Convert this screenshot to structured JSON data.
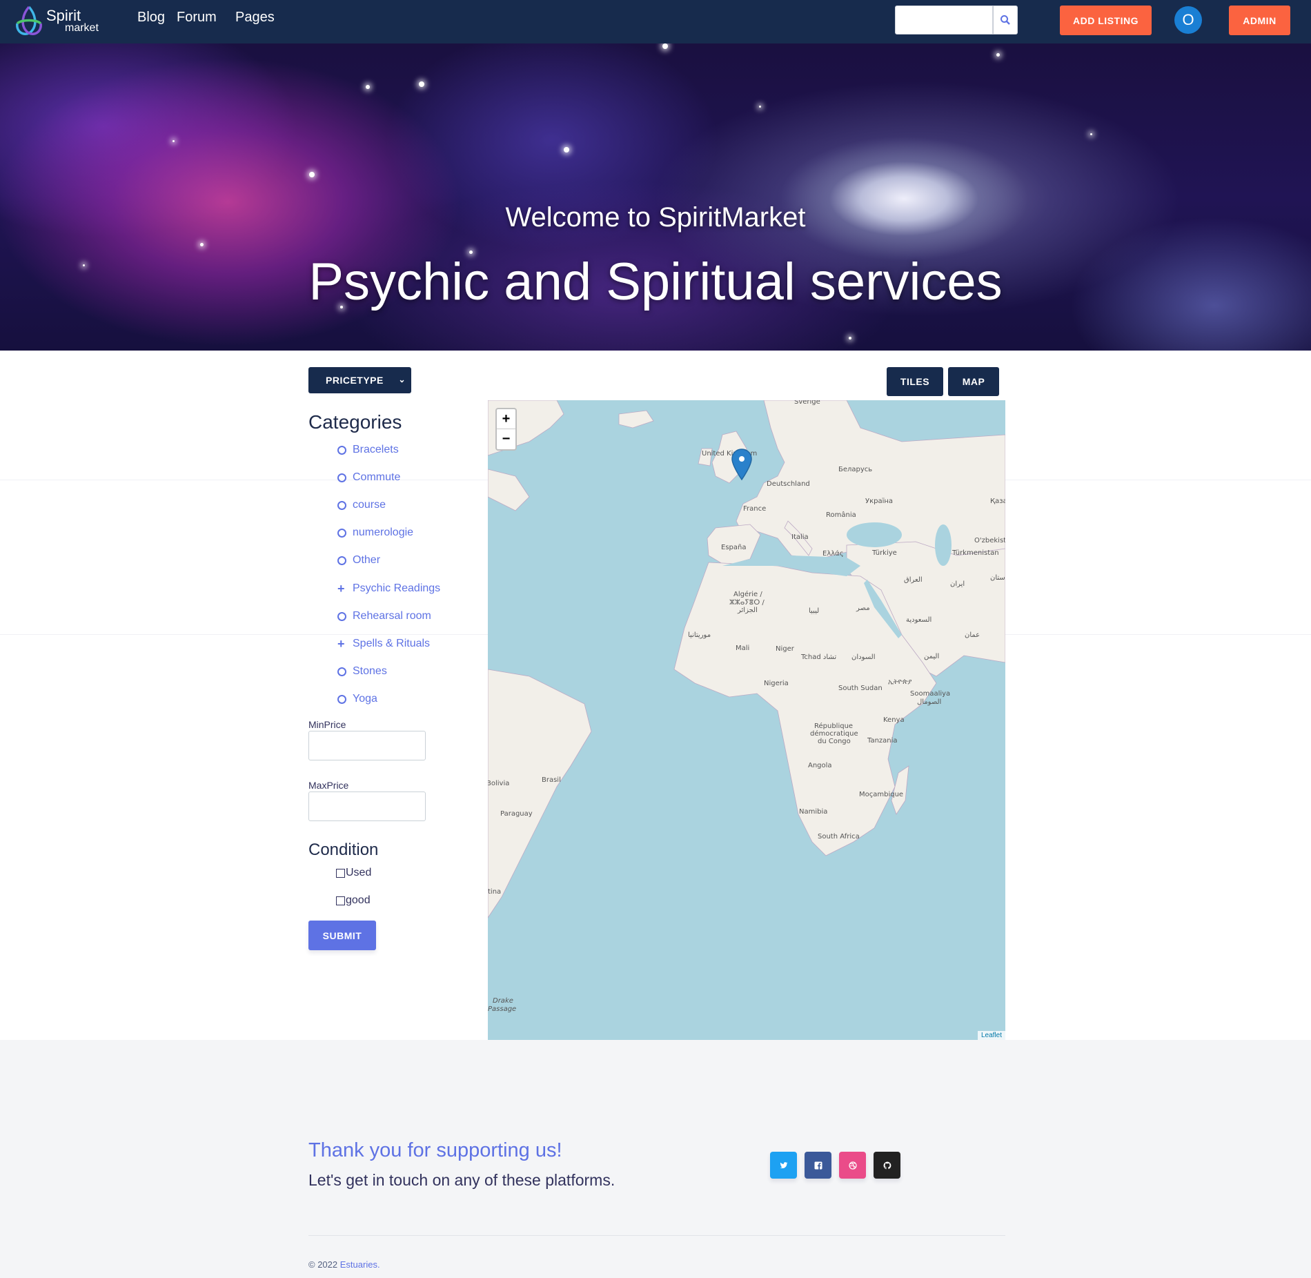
{
  "brand": {
    "line1": "Spirit",
    "line2": "market"
  },
  "nav": {
    "blog": "Blog",
    "forum": "Forum",
    "pages": "Pages"
  },
  "header": {
    "search_placeholder": "",
    "add_listing": "ADD LISTING",
    "avatar_initial": "O",
    "admin": "ADMIN"
  },
  "hero": {
    "subtitle": "Welcome to SpiritMarket",
    "title": "Psychic and Spiritual services"
  },
  "filters": {
    "pricetype": "PRICETYPE",
    "categories_title": "Categories",
    "categories": [
      {
        "label": "Bracelets",
        "icon": "circle"
      },
      {
        "label": "Commute",
        "icon": "circle"
      },
      {
        "label": "course",
        "icon": "circle"
      },
      {
        "label": "numerologie",
        "icon": "circle"
      },
      {
        "label": "Other",
        "icon": "circle"
      },
      {
        "label": "Psychic Readings",
        "icon": "plus"
      },
      {
        "label": "Rehearsal room",
        "icon": "circle"
      },
      {
        "label": "Spells & Rituals",
        "icon": "plus"
      },
      {
        "label": "Stones",
        "icon": "circle"
      },
      {
        "label": "Yoga",
        "icon": "circle"
      }
    ],
    "min_price_label": "MinPrice",
    "max_price_label": "MaxPrice",
    "min_price_value": "",
    "max_price_value": "",
    "condition_title": "Condition",
    "conditions": [
      {
        "label": "Used",
        "checked": false
      },
      {
        "label": "good",
        "checked": false
      }
    ],
    "submit": "SUBMIT"
  },
  "view_toggle": {
    "tiles": "TILES",
    "map": "MAP"
  },
  "map": {
    "zoom_in": "+",
    "zoom_out": "−",
    "attribution": "Leaflet",
    "labels": {
      "sverige": "Sverige",
      "uk": "United Kingdom",
      "belarus": "Беларусь",
      "deutschland": "Deutschland",
      "ukraina": "Україна",
      "kaz": "Қаза",
      "france": "France",
      "romania": "România",
      "uzbek": "O'zbekist",
      "italia": "Italia",
      "espana": "España",
      "ellas": "Ελλάς",
      "turkiye": "Türkiye",
      "turkmen": "Türkmenistan",
      "iraq": "العراق",
      "iran": "ایران",
      "stan": "ستان",
      "algerie": "Algérie /",
      "algerie2": "ⵣⵣⴰⵢⴻⵔ /",
      "algerie3": "الجزائر",
      "libya": "ليبيا",
      "egypt": "مصر",
      "saudi": "السعودية",
      "oman": "عمان",
      "mauritania": "موريتانيا",
      "mali": "Mali",
      "niger": "Niger",
      "tchad": "Tchad تشاد",
      "sudan": "السودان",
      "yemen": "اليمن",
      "nigeria": "Nigeria",
      "ssudan": "South Sudan",
      "ethiopia": "ኢትዮጵያ",
      "somalia": "Soomaaliya",
      "somalia2": "الصومال",
      "kenya": "Kenya",
      "drc1": "République",
      "drc2": "démocratique",
      "drc3": "du Congo",
      "tanzania": "Tanzania",
      "angola": "Angola",
      "bolivia": "Bolivia",
      "brasil": "Brasil",
      "mozambique": "Moçambique",
      "namibia": "Namibia",
      "paraguay": "Paraguay",
      "safrica": "South Africa",
      "argentina": "tina",
      "drake1": "Drake",
      "drake2": "Passage"
    }
  },
  "footer": {
    "thanks": "Thank you for supporting us!",
    "touch": "Let's get in touch on any of these platforms.",
    "copyright": "© 2022",
    "company": "Estuaries.",
    "social": [
      {
        "name": "twitter-icon",
        "color": "#1da1f2"
      },
      {
        "name": "facebook-icon",
        "color": "#3b5999"
      },
      {
        "name": "dribbble-icon",
        "color": "#ea4c89"
      },
      {
        "name": "github-icon",
        "color": "#222222"
      }
    ]
  }
}
